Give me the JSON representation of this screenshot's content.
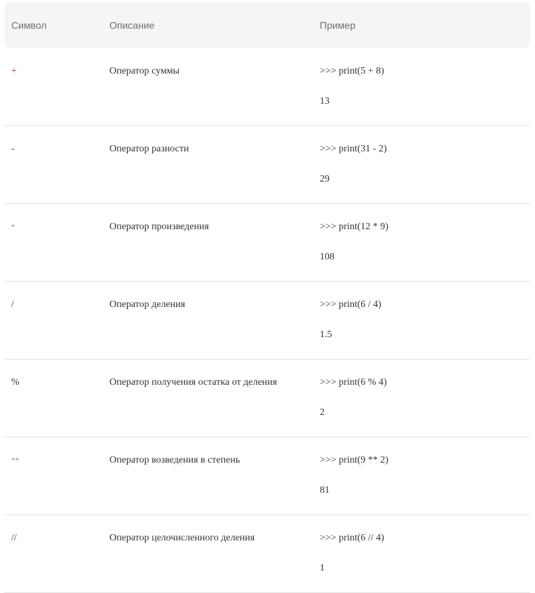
{
  "table": {
    "headers": {
      "symbol": "Символ",
      "description": "Описание",
      "example": "Пример"
    },
    "rows": [
      {
        "symbol": "+",
        "description": "Оператор суммы",
        "code": ">>> print(5 + 8)",
        "result": "13"
      },
      {
        "symbol": "-",
        "description": "Оператор разности",
        "code": ">>> print(31 - 2)",
        "result": "29"
      },
      {
        "symbol": "*",
        "description": "Оператор произведения",
        "code": ">>> print(12 * 9)",
        "result": "108"
      },
      {
        "symbol": "/",
        "description": "Оператор деления",
        "code": ">>> print(6 / 4)",
        "result": "1.5"
      },
      {
        "symbol": "%",
        "description": "Оператор получения остатка от деления",
        "code": ">>> print(6 % 4)",
        "result": "2"
      },
      {
        "symbol": "**",
        "description": "Оператор возведения в степень",
        "code": ">>> print(9 ** 2)",
        "result": "81"
      },
      {
        "symbol": "//",
        "description": "Оператор целочисленного деления",
        "code": ">>> print(6 // 4)",
        "result": "1"
      }
    ]
  },
  "colors": {
    "header_bg": "#f5f5f7",
    "header_text": "#6b6f76",
    "row_text": "#333333",
    "divider": "#e3e3e6"
  }
}
